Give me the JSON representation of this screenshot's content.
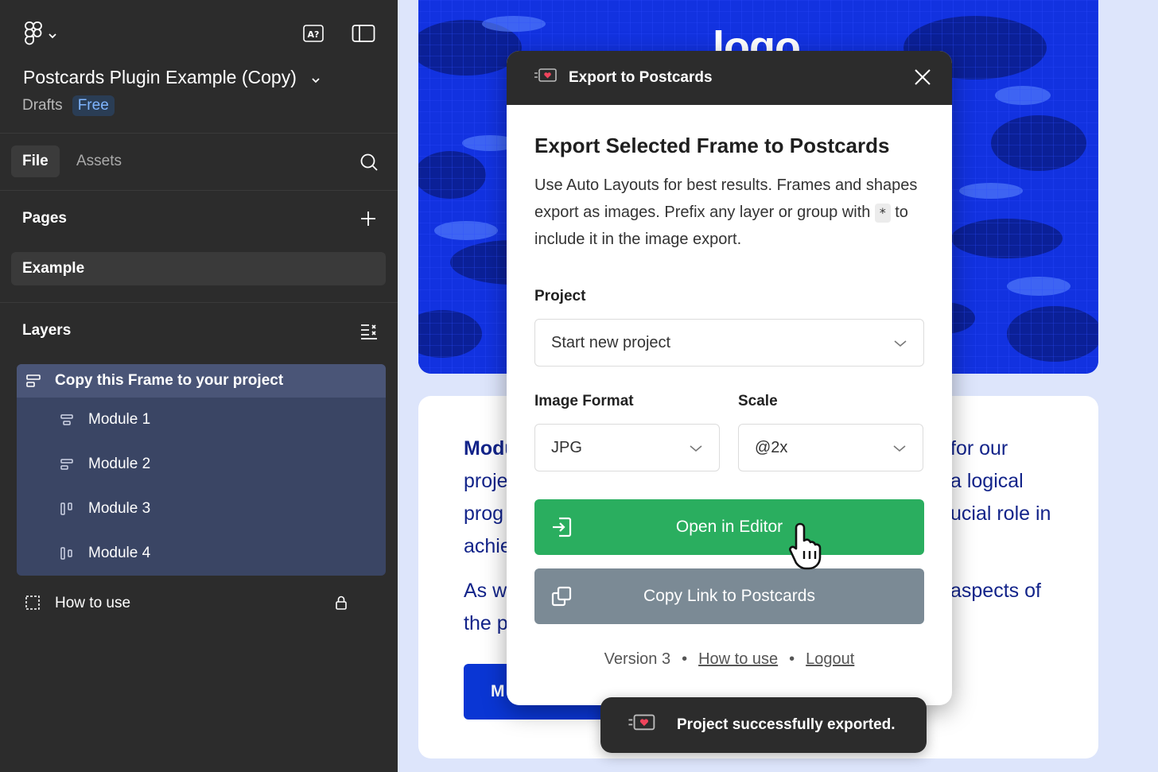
{
  "sidebar": {
    "file_title": "Postcards Plugin Example (Copy)",
    "location": "Drafts",
    "plan_badge": "Free",
    "tabs": [
      {
        "label": "File"
      },
      {
        "label": "Assets"
      }
    ],
    "pages_title": "Pages",
    "pages": [
      {
        "label": "Example"
      }
    ],
    "layers_title": "Layers",
    "layers": {
      "group": "Copy this Frame to your project",
      "children": [
        {
          "label": "Module 1",
          "icon": "auto-layout-vertical-icon"
        },
        {
          "label": "Module 2",
          "icon": "auto-layout-vertical-icon"
        },
        {
          "label": "Module 3",
          "icon": "auto-layout-horizontal-icon"
        },
        {
          "label": "Module 4",
          "icon": "auto-layout-horizontal-icon"
        }
      ],
      "locked": "How to use"
    }
  },
  "canvas": {
    "hero_logo": "logo",
    "para1_bold": "Modu",
    "para1_tail": "for our",
    "para1_l2a": "proje",
    "para1_l2b": "a logical",
    "para1_l3a": "prog",
    "para1_l3b": "ucial role in",
    "para1_l4a": "achie",
    "para2_l1a": "As w",
    "para2_l1b": "aspects of",
    "para2_l2a": "the p",
    "button": "M"
  },
  "modal": {
    "header": "Export to Postcards",
    "title": "Export Selected Frame to Postcards",
    "desc_1": "Use Auto Layouts for best results. Frames and shapes export as images. Prefix any layer or group with",
    "desc_kbd": "*",
    "desc_2": "to include it in the image export.",
    "project_label": "Project",
    "project_value": "Start new project",
    "format_label": "Image Format",
    "format_value": "JPG",
    "scale_label": "Scale",
    "scale_value": "@2x",
    "open_button": "Open in Editor",
    "copy_button": "Copy Link to Postcards",
    "version": "Version 3",
    "how_link": "How to use",
    "logout_link": "Logout",
    "dot": "•"
  },
  "toast": {
    "message": "Project successfully exported."
  },
  "colors": {
    "green": "#2aae5f",
    "gray": "#7b8a95",
    "hero_blue": "#1232e0",
    "text_navy": "#13248a"
  }
}
